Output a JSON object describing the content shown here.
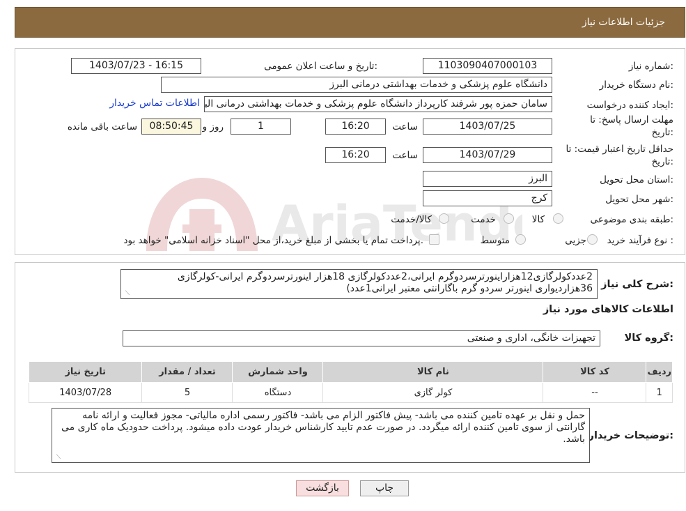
{
  "header": {
    "title": "جزئیات اطلاعات نیاز"
  },
  "fields": {
    "need_number_label": "شماره نیاز:",
    "need_number": "1103090407000103",
    "announce_label": "تاریخ و ساعت اعلان عمومی:",
    "announce_value": "1403/07/23 - 16:15",
    "buyer_org_label": "نام دستگاه خریدار:",
    "buyer_org": "دانشگاه علوم پزشکی و خدمات بهداشتی  درمانی البرز",
    "requester_label": "ایجاد کننده درخواست:",
    "requester": "سامان حمزه پور شرفند کارپرداز دانشگاه علوم پزشکی و خدمات بهداشتی  درمانی البرز",
    "contact_link": "اطلاعات تماس خریدار",
    "deadline_label_1": "مهلت ارسال پاسخ: تا",
    "deadline_label_2": "تاریخ:",
    "deadline_date": "1403/07/25",
    "time_label": "ساعت",
    "deadline_time": "16:20",
    "days_value": "1",
    "days_label": "روز و",
    "remaining_time": "08:50:45",
    "remaining_label": "ساعت باقی مانده",
    "validity_label_1": "حداقل تاریخ اعتبار قیمت: تا",
    "validity_label_2": "تاریخ:",
    "validity_date": "1403/07/29",
    "validity_time": "16:20",
    "province_label": "استان محل تحویل:",
    "province": "البرز",
    "city_label": "شهر محل تحویل:",
    "city": "کرج",
    "category_label": "طبقه بندی موضوعی:",
    "category_options": [
      "کالا",
      "خدمت",
      "کالا/خدمت"
    ],
    "process_label": "نوع فرآیند خرید :",
    "process_options": [
      "جزیی",
      "متوسط"
    ],
    "process_note": "پرداخت تمام یا بخشی از مبلغ خرید،از محل \"اسناد خزانه اسلامی\" خواهد بود."
  },
  "watermark": {
    "text": "AriaTender.neT"
  },
  "description": {
    "label": "شرح کلی نیاز:",
    "text": "2عددکولرگازی12هزاراینورترسردوگرم ایرانی،2عددکولرگازی 18هزار اینورترسردوگرم ایرانی-کولرگازی 36هزاردیواری اینورتر سردو گرم باگارانتی معتبر ایرانی1عدد)"
  },
  "goods_info_title": "اطلاعات کالاهای مورد نیاز",
  "goods_group": {
    "label": "گروه کالا:",
    "value": "تجهیزات خانگی، اداری و صنعتی"
  },
  "table": {
    "headers": [
      "ردیف",
      "کد کالا",
      "نام کالا",
      "واحد شمارش",
      "تعداد / مقدار",
      "تاریخ نیاز"
    ],
    "rows": [
      [
        "1",
        "--",
        "کولر گازی",
        "دستگاه",
        "5",
        "1403/07/28"
      ]
    ]
  },
  "buyer_notes": {
    "label": "توضیحات خریدار:",
    "text": "حمل و نقل بر عهده تامین کننده می باشد- پیش فاکتور الزام می باشد- فاکتور رسمی اداره مالیاتی- مجوز فعالیت و ارائه نامه گارانتی از سوی تامین کننده ارائه میگردد. در صورت عدم تایید کارشناس خریدار عودت داده میشود. پرداخت حدودیک ماه کاری می باشد."
  },
  "buttons": {
    "print": "چاپ",
    "back": "بازگشت"
  },
  "colors": {
    "header_bg": "#8b6a3f",
    "link": "#1a3ccf",
    "back_button_bg": "#f8dede"
  }
}
